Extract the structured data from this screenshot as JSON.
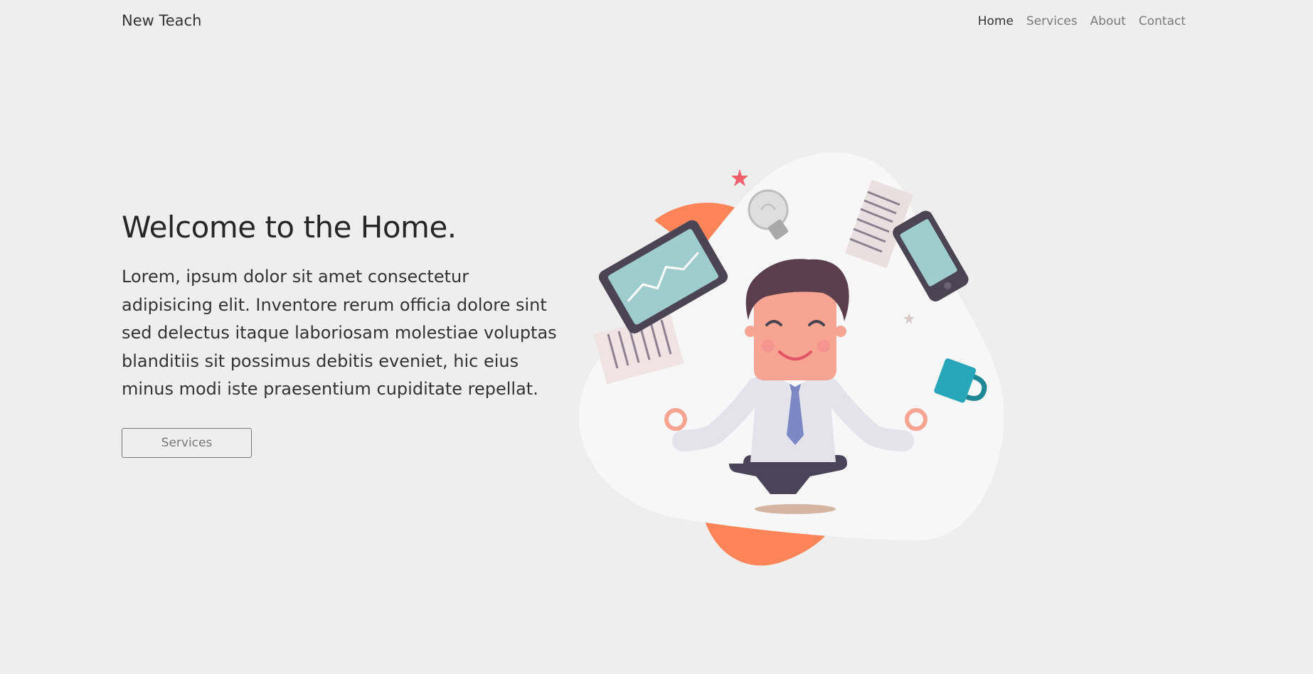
{
  "nav": {
    "brand": "New Teach",
    "links": [
      "Home",
      "Services",
      "About",
      "Contact"
    ]
  },
  "hero": {
    "title": "Welcome to the Home.",
    "body": "Lorem, ipsum dolor sit amet consectetur adipisicing elit. Inventore rerum officia dolore sint sed delectus itaque laboriosam molestiae voluptas blanditiis sit possimus debitis eveniet, hic eius minus modi iste praesentium cupiditate repellat.",
    "button": "Services"
  },
  "colors": {
    "background": "#eeeeee",
    "accent_orange": "#ff8559",
    "blob": "#f7f7f7"
  }
}
